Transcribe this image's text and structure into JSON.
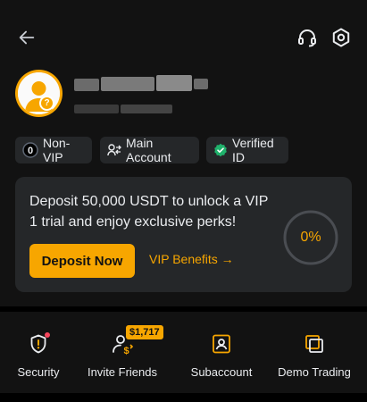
{
  "header": {
    "back_icon": "arrow-left-icon",
    "support_icon": "headset-icon",
    "settings_icon": "hexagon-settings-icon"
  },
  "profile": {
    "avatar_icon": "user-avatar-icon",
    "badge_symbol": "?"
  },
  "tags": {
    "vip": {
      "icon": "vip-zero-icon",
      "icon_text": "0",
      "label": "Non-VIP"
    },
    "account": {
      "icon": "user-switch-icon",
      "label": "Main Account"
    },
    "verified": {
      "icon": "verified-check-icon",
      "label": "Verified ID"
    }
  },
  "vip_card": {
    "message": "Deposit 50,000 USDT to unlock a VIP 1 trial and enjoy exclusive perks!",
    "deposit_label": "Deposit Now",
    "benefits_label": "VIP Benefits →",
    "progress_text": "0%",
    "progress_value": 0
  },
  "quick_actions": [
    {
      "icon": "shield-alert-icon",
      "label": "Security"
    },
    {
      "icon": "invite-friends-icon",
      "label": "Invite Friends",
      "badge": "$1,717"
    },
    {
      "icon": "subaccount-icon",
      "label": "Subaccount"
    },
    {
      "icon": "demo-trading-icon",
      "label": "Demo Trading"
    }
  ],
  "colors": {
    "accent": "#f7a600",
    "background": "#121212",
    "card": "#252729",
    "verified": "#20b26c",
    "alert": "#f6465d"
  }
}
